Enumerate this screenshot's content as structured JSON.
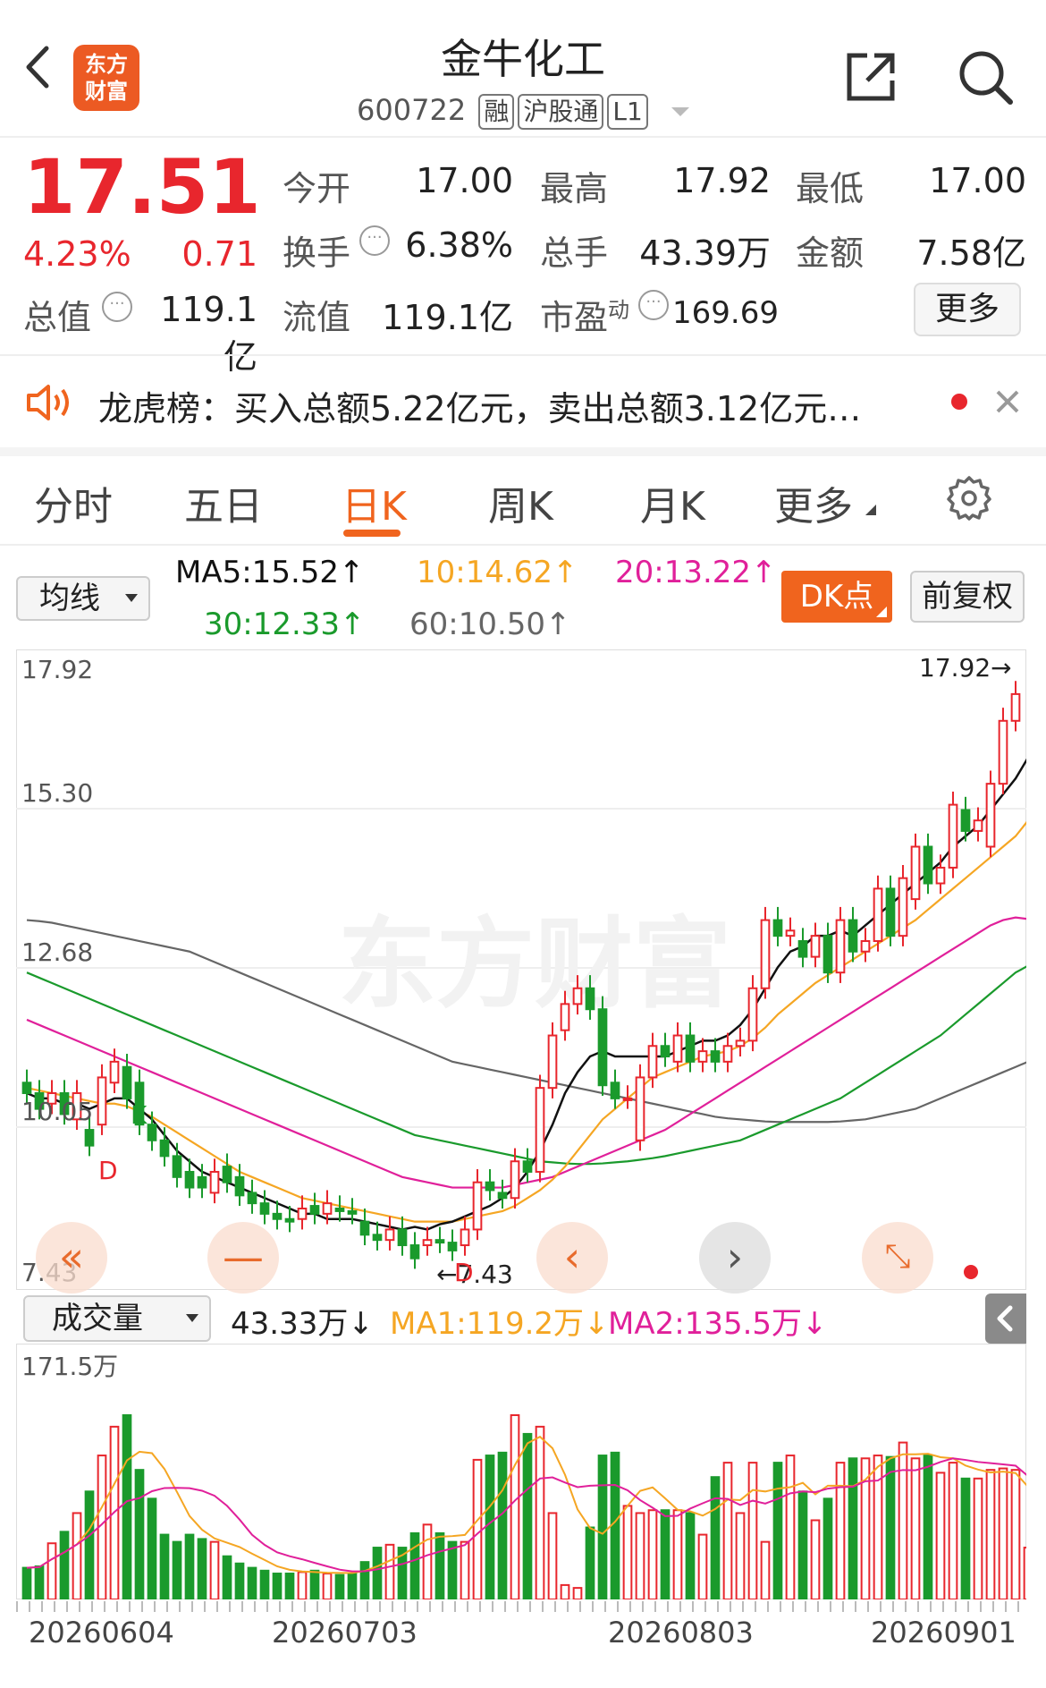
{
  "header": {
    "title": "金牛化工",
    "code": "600722",
    "tags": [
      "融",
      "沪股通",
      "L1"
    ],
    "logo_text": [
      "东方",
      "财富"
    ]
  },
  "quote": {
    "price": "17.51",
    "change_pct": "4.23%",
    "change_abs": "0.71",
    "open_label": "今开",
    "open": "17.00",
    "high_label": "最高",
    "high": "17.92",
    "low_label": "最低",
    "low": "17.00",
    "turnover_label": "换手",
    "turnover": "6.38%",
    "volume_label": "总手",
    "volume": "43.39万",
    "amount_label": "金额",
    "amount": "7.58亿",
    "mktcap_label": "总值",
    "mktcap": "119.1亿",
    "float_label": "流值",
    "float_cap": "119.1亿",
    "pe_label": "市盈",
    "pe_sup": "动",
    "pe": "169.69",
    "more": "更多"
  },
  "notice": {
    "text": "龙虎榜：买入总额5.22亿元，卖出总额3.12亿元…"
  },
  "tabs": [
    "分时",
    "五日",
    "日K",
    "周K",
    "月K",
    "更多"
  ],
  "active_tab": "日K",
  "ma_bar": {
    "selector": "均线",
    "ma5": "MA5:15.52↑",
    "ma10": "10:14.62↑",
    "ma20": "20:13.22↑",
    "ma30": "30:12.33↑",
    "ma60": "60:10.50↑",
    "dk_button": "DK点",
    "fq_button": "前复权"
  },
  "kline": {
    "y_labels": [
      "17.92",
      "15.30",
      "12.68",
      "10.05",
      "7.43"
    ],
    "max_label": "17.92→",
    "min_label": "←7.43",
    "markers": [
      "D",
      "K",
      "D"
    ],
    "watermark": "东方财富"
  },
  "volume": {
    "selector": "成交量",
    "current": "43.33万↓",
    "ma1": "MA1:119.2万↓",
    "ma2": "MA2:135.5万↓",
    "top_label": "171.5万"
  },
  "x_labels": [
    "20260604",
    "20260703",
    "20260803",
    "20260901"
  ],
  "colors": {
    "up": "#e8262d",
    "down": "#1a9a2c",
    "ma5": "#111111",
    "ma10": "#f5a623",
    "ma20": "#e0209a",
    "ma30": "#1a9a2c",
    "ma60": "#666666",
    "accent": "#f0641e"
  },
  "chart_data": {
    "type": "candlestick",
    "ylim": [
      7.43,
      17.92
    ],
    "candles": [
      {
        "o": 10.1,
        "c": 9.9
      },
      {
        "o": 9.9,
        "c": 9.6
      },
      {
        "o": 9.7,
        "c": 9.9
      },
      {
        "o": 9.9,
        "c": 9.5
      },
      {
        "o": 9.4,
        "c": 9.9
      },
      {
        "o": 9.2,
        "c": 8.9
      },
      {
        "o": 9.3,
        "c": 10.2
      },
      {
        "o": 10.1,
        "c": 10.5
      },
      {
        "o": 10.4,
        "c": 9.8
      },
      {
        "o": 10.1,
        "c": 9.3
      },
      {
        "o": 9.3,
        "c": 9.0
      },
      {
        "o": 9.0,
        "c": 8.7
      },
      {
        "o": 8.7,
        "c": 8.3
      },
      {
        "o": 8.4,
        "c": 8.1
      },
      {
        "o": 8.3,
        "c": 8.1
      },
      {
        "o": 8.0,
        "c": 8.4
      },
      {
        "o": 8.5,
        "c": 8.2
      },
      {
        "o": 8.3,
        "c": 7.95
      },
      {
        "o": 8.0,
        "c": 7.8
      },
      {
        "o": 7.8,
        "c": 7.6
      },
      {
        "o": 7.6,
        "c": 7.5
      },
      {
        "o": 7.5,
        "c": 7.45
      },
      {
        "o": 7.5,
        "c": 7.7
      },
      {
        "o": 7.75,
        "c": 7.6
      },
      {
        "o": 7.6,
        "c": 7.8
      },
      {
        "o": 7.7,
        "c": 7.65
      },
      {
        "o": 7.65,
        "c": 7.6
      },
      {
        "o": 7.45,
        "c": 7.2
      },
      {
        "o": 7.2,
        "c": 7.1
      },
      {
        "o": 7.1,
        "c": 7.3
      },
      {
        "o": 7.3,
        "c": 7.0
      },
      {
        "o": 7.0,
        "c": 6.75
      },
      {
        "o": 7.0,
        "c": 7.1
      },
      {
        "o": 7.1,
        "c": 7.05
      },
      {
        "o": 7.05,
        "c": 6.9
      },
      {
        "o": 7.0,
        "c": 7.3
      },
      {
        "o": 7.3,
        "c": 8.2
      },
      {
        "o": 8.2,
        "c": 8.05
      },
      {
        "o": 8.0,
        "c": 7.9
      },
      {
        "o": 7.9,
        "c": 8.6
      },
      {
        "o": 8.6,
        "c": 8.4
      },
      {
        "o": 8.4,
        "c": 10.0
      },
      {
        "o": 10.0,
        "c": 11.0
      },
      {
        "o": 11.1,
        "c": 11.6
      },
      {
        "o": 11.6,
        "c": 11.9
      },
      {
        "o": 11.9,
        "c": 11.5
      },
      {
        "o": 11.5,
        "c": 10.05
      },
      {
        "o": 10.1,
        "c": 9.8
      },
      {
        "o": 9.8,
        "c": 9.8
      },
      {
        "o": 9.0,
        "c": 10.2
      },
      {
        "o": 10.2,
        "c": 10.8
      },
      {
        "o": 10.8,
        "c": 10.6
      },
      {
        "o": 10.5,
        "c": 11.0
      },
      {
        "o": 11.0,
        "c": 10.5
      },
      {
        "o": 10.5,
        "c": 10.7
      },
      {
        "o": 10.7,
        "c": 10.5
      },
      {
        "o": 10.5,
        "c": 10.8
      },
      {
        "o": 10.8,
        "c": 10.9
      },
      {
        "o": 10.9,
        "c": 11.9
      },
      {
        "o": 11.9,
        "c": 13.2
      },
      {
        "o": 13.2,
        "c": 12.9
      },
      {
        "o": 12.9,
        "c": 13.0
      },
      {
        "o": 12.8,
        "c": 12.5
      },
      {
        "o": 12.5,
        "c": 12.9
      },
      {
        "o": 12.9,
        "c": 12.2
      },
      {
        "o": 12.2,
        "c": 13.2
      },
      {
        "o": 13.2,
        "c": 12.6
      },
      {
        "o": 12.6,
        "c": 12.8
      },
      {
        "o": 12.8,
        "c": 13.8
      },
      {
        "o": 13.8,
        "c": 12.9
      },
      {
        "o": 12.9,
        "c": 14.0
      },
      {
        "o": 13.6,
        "c": 14.6
      },
      {
        "o": 14.6,
        "c": 13.9
      },
      {
        "o": 13.9,
        "c": 14.2
      },
      {
        "o": 14.2,
        "c": 15.4
      },
      {
        "o": 15.3,
        "c": 14.9
      },
      {
        "o": 14.9,
        "c": 15.1
      },
      {
        "o": 14.6,
        "c": 15.8
      },
      {
        "o": 15.8,
        "c": 17.0
      },
      {
        "o": 17.0,
        "c": 17.51
      }
    ],
    "ma5": [
      9.9,
      9.8,
      9.8,
      9.7,
      9.7,
      9.6,
      9.7,
      9.8,
      9.8,
      9.6,
      9.4,
      9.1,
      8.8,
      8.6,
      8.4,
      8.3,
      8.2,
      8.1,
      8.0,
      7.9,
      7.8,
      7.7,
      7.6,
      7.6,
      7.5,
      7.5,
      7.5,
      7.45,
      7.4,
      7.35,
      7.3,
      7.35,
      7.3,
      7.4,
      7.45,
      7.55,
      7.65,
      7.75,
      7.9,
      8.1,
      8.4,
      8.8,
      9.3,
      9.9,
      10.3,
      10.6,
      10.7,
      10.6,
      10.6,
      10.6,
      10.6,
      10.6,
      10.7,
      10.8,
      10.9,
      10.9,
      11.0,
      11.2,
      11.5,
      11.9,
      12.3,
      12.6,
      12.7,
      12.9,
      12.9,
      13.0,
      12.9,
      13.1,
      13.3,
      13.5,
      13.7,
      13.9,
      14.1,
      14.3,
      14.6,
      14.8,
      15.0,
      15.3,
      15.6,
      15.9,
      16.3
    ],
    "ma10": [
      10.0,
      9.95,
      9.9,
      9.85,
      9.8,
      9.75,
      9.7,
      9.7,
      9.65,
      9.55,
      9.45,
      9.3,
      9.15,
      9.0,
      8.85,
      8.7,
      8.55,
      8.4,
      8.3,
      8.2,
      8.1,
      8.0,
      7.9,
      7.85,
      7.8,
      7.75,
      7.7,
      7.65,
      7.6,
      7.55,
      7.5,
      7.45,
      7.45,
      7.45,
      7.45,
      7.5,
      7.55,
      7.6,
      7.65,
      7.75,
      7.9,
      8.05,
      8.25,
      8.5,
      8.8,
      9.1,
      9.4,
      9.6,
      9.8,
      10.0,
      10.2,
      10.3,
      10.4,
      10.5,
      10.6,
      10.65,
      10.7,
      10.8,
      10.95,
      11.15,
      11.4,
      11.6,
      11.8,
      12.0,
      12.15,
      12.3,
      12.45,
      12.6,
      12.75,
      12.9,
      13.05,
      13.2,
      13.4,
      13.6,
      13.8,
      14.0,
      14.2,
      14.4,
      14.6,
      14.8,
      15.1
    ],
    "ma20": [
      11.3,
      11.2,
      11.1,
      11.0,
      10.9,
      10.8,
      10.7,
      10.6,
      10.5,
      10.4,
      10.3,
      10.2,
      10.1,
      10.0,
      9.9,
      9.8,
      9.7,
      9.6,
      9.5,
      9.4,
      9.3,
      9.2,
      9.1,
      9.0,
      8.9,
      8.8,
      8.7,
      8.6,
      8.5,
      8.4,
      8.3,
      8.25,
      8.2,
      8.15,
      8.1,
      8.1,
      8.1,
      8.1,
      8.1,
      8.15,
      8.2,
      8.25,
      8.3,
      8.4,
      8.5,
      8.6,
      8.7,
      8.8,
      8.9,
      9.0,
      9.1,
      9.2,
      9.35,
      9.5,
      9.65,
      9.8,
      9.95,
      10.1,
      10.25,
      10.4,
      10.55,
      10.7,
      10.85,
      11.0,
      11.15,
      11.3,
      11.45,
      11.6,
      11.75,
      11.9,
      12.05,
      12.2,
      12.35,
      12.5,
      12.65,
      12.8,
      12.95,
      13.1,
      13.2,
      13.25,
      13.22
    ],
    "ma30": [
      12.2,
      12.1,
      12.0,
      11.9,
      11.8,
      11.7,
      11.6,
      11.5,
      11.4,
      11.3,
      11.2,
      11.1,
      11.0,
      10.9,
      10.8,
      10.7,
      10.6,
      10.5,
      10.4,
      10.3,
      10.2,
      10.1,
      10.0,
      9.9,
      9.8,
      9.7,
      9.6,
      9.5,
      9.4,
      9.3,
      9.2,
      9.1,
      9.05,
      9.0,
      8.95,
      8.9,
      8.85,
      8.8,
      8.75,
      8.7,
      8.65,
      8.6,
      8.58,
      8.56,
      8.55,
      8.55,
      8.56,
      8.58,
      8.6,
      8.63,
      8.66,
      8.7,
      8.75,
      8.8,
      8.85,
      8.9,
      8.95,
      9.0,
      9.1,
      9.2,
      9.3,
      9.4,
      9.5,
      9.6,
      9.7,
      9.8,
      9.95,
      10.1,
      10.25,
      10.4,
      10.55,
      10.7,
      10.85,
      11.0,
      11.2,
      11.4,
      11.6,
      11.8,
      12.0,
      12.2,
      12.33
    ],
    "ma60": [
      13.2,
      13.18,
      13.15,
      13.1,
      13.05,
      13.0,
      12.95,
      12.9,
      12.85,
      12.8,
      12.75,
      12.7,
      12.65,
      12.6,
      12.5,
      12.4,
      12.3,
      12.2,
      12.1,
      12.0,
      11.9,
      11.8,
      11.7,
      11.6,
      11.5,
      11.4,
      11.3,
      11.2,
      11.1,
      11.0,
      10.9,
      10.8,
      10.7,
      10.6,
      10.5,
      10.45,
      10.4,
      10.35,
      10.3,
      10.25,
      10.2,
      10.15,
      10.1,
      10.05,
      10.0,
      9.95,
      9.9,
      9.85,
      9.8,
      9.75,
      9.7,
      9.65,
      9.6,
      9.55,
      9.5,
      9.45,
      9.42,
      9.4,
      9.38,
      9.36,
      9.35,
      9.35,
      9.35,
      9.35,
      9.35,
      9.36,
      9.38,
      9.4,
      9.45,
      9.5,
      9.55,
      9.6,
      9.7,
      9.8,
      9.9,
      10.0,
      10.1,
      10.2,
      10.3,
      10.4,
      10.5
    ],
    "volumes": [
      22,
      23,
      39,
      47,
      60,
      75,
      100,
      120,
      128,
      90,
      70,
      45,
      40,
      45,
      42,
      40,
      30,
      25,
      22,
      20,
      18,
      18,
      19,
      20,
      18,
      17,
      18,
      26,
      36,
      38,
      36,
      46,
      52,
      46,
      40,
      40,
      97,
      100,
      102,
      128,
      115,
      120,
      60,
      10,
      8,
      50,
      100,
      102,
      65,
      60,
      62,
      62,
      62,
      60,
      45,
      85,
      95,
      60,
      95,
      40,
      95,
      100,
      75,
      55,
      70,
      95,
      98,
      98,
      100,
      99,
      109,
      98,
      100,
      88,
      95,
      84,
      84,
      90,
      91,
      90,
      36
    ],
    "volume_ylim": [
      0,
      171.5
    ]
  }
}
